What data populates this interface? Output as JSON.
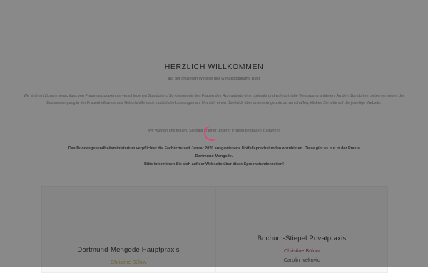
{
  "welcome": {
    "title": "HERZLICH WILLKOMMEN",
    "subtitle": "auf der offiziellen Website des Gynäkologikums Ruhr",
    "intro": "Wir sind ein Zusammenschluss von Frauenarztpraxen an verschiedenen Standorten. So können wir den Frauen des Ruhrgebiets eine optimale und wohnortnahe Versorgung anbieten. An den Standorten bieten wir neben der Basisversorgung in der Frauenheilkunde und Geburtshilfe noch zusätzliche Leistungen an. Um sich einen Überblick über unsere Angebote zu verschaffen, klicken Sie bitte auf die jeweilige Website.",
    "greeting": "Wir würden uns freuen, Sie bald in einer unserer Praxen begrüßen zu dürfen!"
  },
  "notice": {
    "line1": "Das Bundesgesundheitsministerium verpflichtet die Fachärzte seit Januar 2020 ausgewiesene Notfallsprechstunden anzubieten. Diese gibt es nur in der Praxis",
    "line2": "Dortmund-Mengede.",
    "line3": "Bitte informieren Sie sich auf der Webseite über diese Sprechstundenzeiten!"
  },
  "practices": [
    {
      "name": "Dortmund-Mengede Hauptpraxis",
      "doctors": [
        "Christine Bülow"
      ]
    },
    {
      "name": "Bochum-Stiepel Privatpraxis",
      "doctors": [
        "Christine Bülow",
        "Carolin Ivekovic"
      ]
    }
  ],
  "colors": {
    "overlay": "#141414",
    "spinner": "#e0467c",
    "accent_pink": "#b23a68",
    "accent_gold": "#c7b24a"
  },
  "loading_indicator": "spinner-icon"
}
